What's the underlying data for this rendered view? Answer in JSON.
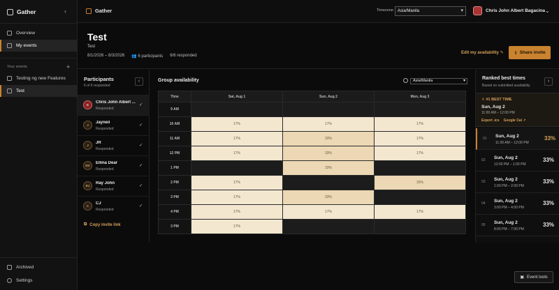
{
  "sidebar": {
    "brand": "Gather",
    "items": [
      {
        "label": "Overview"
      },
      {
        "label": "My events"
      }
    ],
    "section_label": "Your events",
    "events": [
      {
        "label": "Testing ng new Features"
      },
      {
        "label": "Test"
      }
    ],
    "footer": [
      {
        "label": "Archived"
      },
      {
        "label": "Settings"
      }
    ]
  },
  "topbar": {
    "title": "Gather",
    "timezone_label": "Timezone",
    "timezone_value": "Asia/Manila",
    "user_name": "Chris John Albert Bagacina"
  },
  "event": {
    "title": "Test",
    "subtitle": "Test",
    "date_range": "8/1/2026 – 8/3/2026",
    "participants_count": "6 participants",
    "responded": "6/6 responded",
    "edit_label": "Edit my availability",
    "share_label": "Share invite"
  },
  "participants": {
    "title": "Participants",
    "subtitle": "6 of 6 responded",
    "list": [
      {
        "initials": "C",
        "name": "Chris John Albert ...",
        "status": "Responded"
      },
      {
        "initials": "J",
        "name": "Jayneil",
        "status": "Responded"
      },
      {
        "initials": "J",
        "name": "JR",
        "status": "Responded"
      },
      {
        "initials": "ED",
        "name": "Ellina Dear",
        "status": "Responded"
      },
      {
        "initials": "RJ",
        "name": "Ray John",
        "status": "Responded"
      },
      {
        "initials": "C",
        "name": "CJ",
        "status": "Responded"
      }
    ],
    "copy_link": "Copy invite link"
  },
  "availability": {
    "title": "Group availability",
    "timezone": "Asia/Manila",
    "time_header": "Time",
    "days": [
      "Sat, Aug 1",
      "Sun, Aug 2",
      "Mon, Aug 3"
    ],
    "rows": [
      {
        "time": "9 AM",
        "cells": [
          "",
          "",
          ""
        ]
      },
      {
        "time": "10 AM",
        "cells": [
          "17%",
          "17%",
          "17%"
        ]
      },
      {
        "time": "11 AM",
        "cells": [
          "17%",
          "33%",
          "17%"
        ]
      },
      {
        "time": "12 PM",
        "cells": [
          "17%",
          "33%",
          "17%"
        ]
      },
      {
        "time": "1 PM",
        "cells": [
          "",
          "33%",
          ""
        ]
      },
      {
        "time": "2 PM",
        "cells": [
          "17%",
          "",
          "33%"
        ]
      },
      {
        "time": "3 PM",
        "cells": [
          "17%",
          "33%",
          ""
        ]
      },
      {
        "time": "4 PM",
        "cells": [
          "17%",
          "17%",
          "17%"
        ]
      },
      {
        "time": "3 PM",
        "cells": [
          "17%",
          "",
          ""
        ]
      }
    ]
  },
  "ranked": {
    "title": "Ranked best times",
    "subtitle": "Based on submitted availability",
    "best_tag": "#1 BEST TIME",
    "best_day": "Sun, Aug 2",
    "best_time": "11:00 AM – 12:00 PM",
    "export_ics": "Export .ics",
    "google_cal": "Google Cal ↗",
    "list": [
      {
        "rank": "01",
        "day": "Sun, Aug 2",
        "time": "11:00 AM – 12:00 PM",
        "pct": "33%"
      },
      {
        "rank": "02",
        "day": "Sun, Aug 2",
        "time": "12:00 PM – 1:00 PM",
        "pct": "33%"
      },
      {
        "rank": "03",
        "day": "Sun, Aug 2",
        "time": "1:00 PM – 2:00 PM",
        "pct": "33%"
      },
      {
        "rank": "04",
        "day": "Sun, Aug 2",
        "time": "3:00 PM – 4:00 PM",
        "pct": "33%"
      },
      {
        "rank": "05",
        "day": "Sun, Aug 2",
        "time": "8:00 PM – 7:00 PM",
        "pct": "33%"
      }
    ]
  },
  "tools": {
    "label": "Event tools"
  },
  "colors": {
    "accent": "#c9822f",
    "slot_low": "#f3e7d0",
    "slot_mid": "#ecd8b4"
  }
}
